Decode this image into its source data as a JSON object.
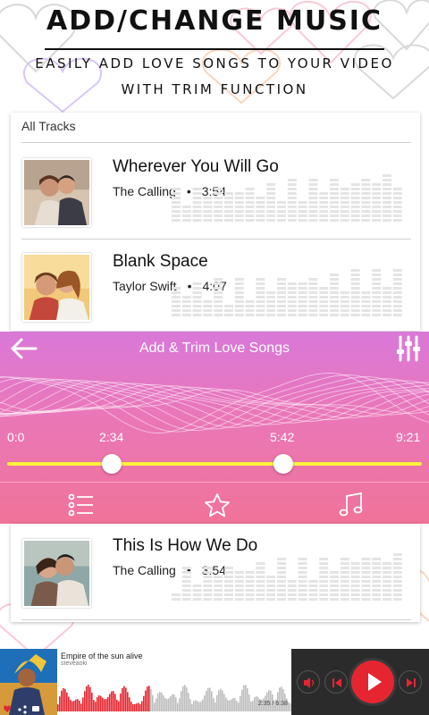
{
  "promo": {
    "title": "ADD/CHANGE MUSIC",
    "subtitle_line1": "EASILY ADD LOVE SONGS TO YOUR VIDEO",
    "subtitle_line2": "WITH TRIM FUNCTION"
  },
  "track_list": {
    "header": "All Tracks",
    "tracks": [
      {
        "title": "Wherever You Will Go",
        "artist": "The Calling",
        "separator": "•",
        "duration": "3:54"
      },
      {
        "title": "Blank Space",
        "artist": "Taylor Swift",
        "separator": "•",
        "duration": "4:07"
      },
      {
        "title": "This Is How We Do",
        "artist": "The Calling",
        "separator": "•",
        "duration": "3:54"
      }
    ]
  },
  "player": {
    "title": "Add & Trim Love Songs",
    "times": [
      "0:0",
      "2:34",
      "5:42",
      "9:21"
    ],
    "trim_start_fraction": 0.25,
    "trim_end_fraction": 0.61,
    "icons": {
      "back": "back-arrow-icon",
      "equalizer": "equalizer-icon",
      "playlist": "playlist-icon",
      "favorite": "star-icon",
      "music": "music-note-icon"
    },
    "colors": {
      "gradient_top": "#d978d9",
      "gradient_bottom": "#f07398",
      "slider": "#fff23a"
    }
  },
  "mini_player": {
    "title": "Empire of the sun alive",
    "artist": "steveaoki",
    "time": "2:35 / 6:38",
    "progress_fraction": 0.39,
    "accent": "#e52631"
  }
}
